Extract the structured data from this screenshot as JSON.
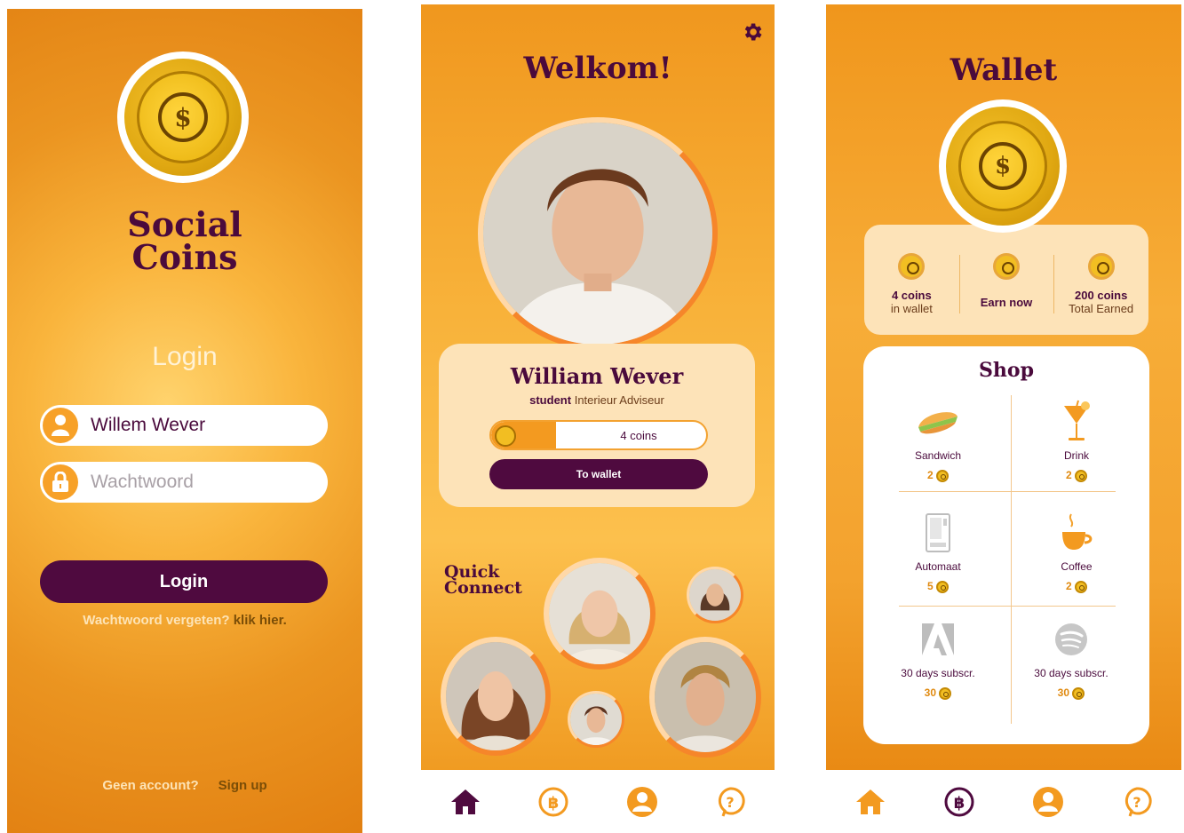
{
  "login_screen": {
    "app_name_line1": "Social",
    "app_name_line2": "Coins",
    "heading": "Login",
    "username_value": "Willem Wever",
    "password_placeholder": "Wachtwoord",
    "login_button": "Login",
    "forgot_text": "Wachtwoord vergeten?",
    "forgot_link": "klik hier.",
    "no_account": "Geen account?",
    "sign_up": "Sign up"
  },
  "home_screen": {
    "title": "Welkom!",
    "user_name": "William Wever",
    "user_role_prefix": "student",
    "user_role": "Interieur Adviseur",
    "coins_label": "4 coins",
    "coins_progress": 0.3,
    "wallet_button": "To wallet",
    "quick_connect_line1": "Quick",
    "quick_connect_line2": "Connect"
  },
  "wallet_screen": {
    "title": "Wallet",
    "stats": [
      {
        "line1": "4 coins",
        "line2": "in wallet"
      },
      {
        "line1": "Earn now",
        "line2": ""
      },
      {
        "line1": "200 coins",
        "line2": "Total Earned"
      }
    ],
    "shop_title": "Shop",
    "items": [
      {
        "name": "Sandwich",
        "price": "2",
        "icon": "sandwich-icon"
      },
      {
        "name": "Drink",
        "price": "2",
        "icon": "cocktail-icon"
      },
      {
        "name": "Automaat",
        "price": "5",
        "icon": "vending-machine-icon"
      },
      {
        "name": "Coffee",
        "price": "2",
        "icon": "coffee-cup-icon"
      },
      {
        "name": "30 days subscr.",
        "price": "30",
        "icon": "adobe-icon"
      },
      {
        "name": "30 days subscr.",
        "price": "30",
        "icon": "spotify-icon"
      }
    ]
  },
  "nav": [
    "home-icon",
    "bitcoin-icon",
    "profile-icon",
    "help-icon"
  ],
  "colors": {
    "brand_purple": "#4f0a3f",
    "brand_orange": "#f39a20",
    "coin_gold": "#f2be22"
  }
}
